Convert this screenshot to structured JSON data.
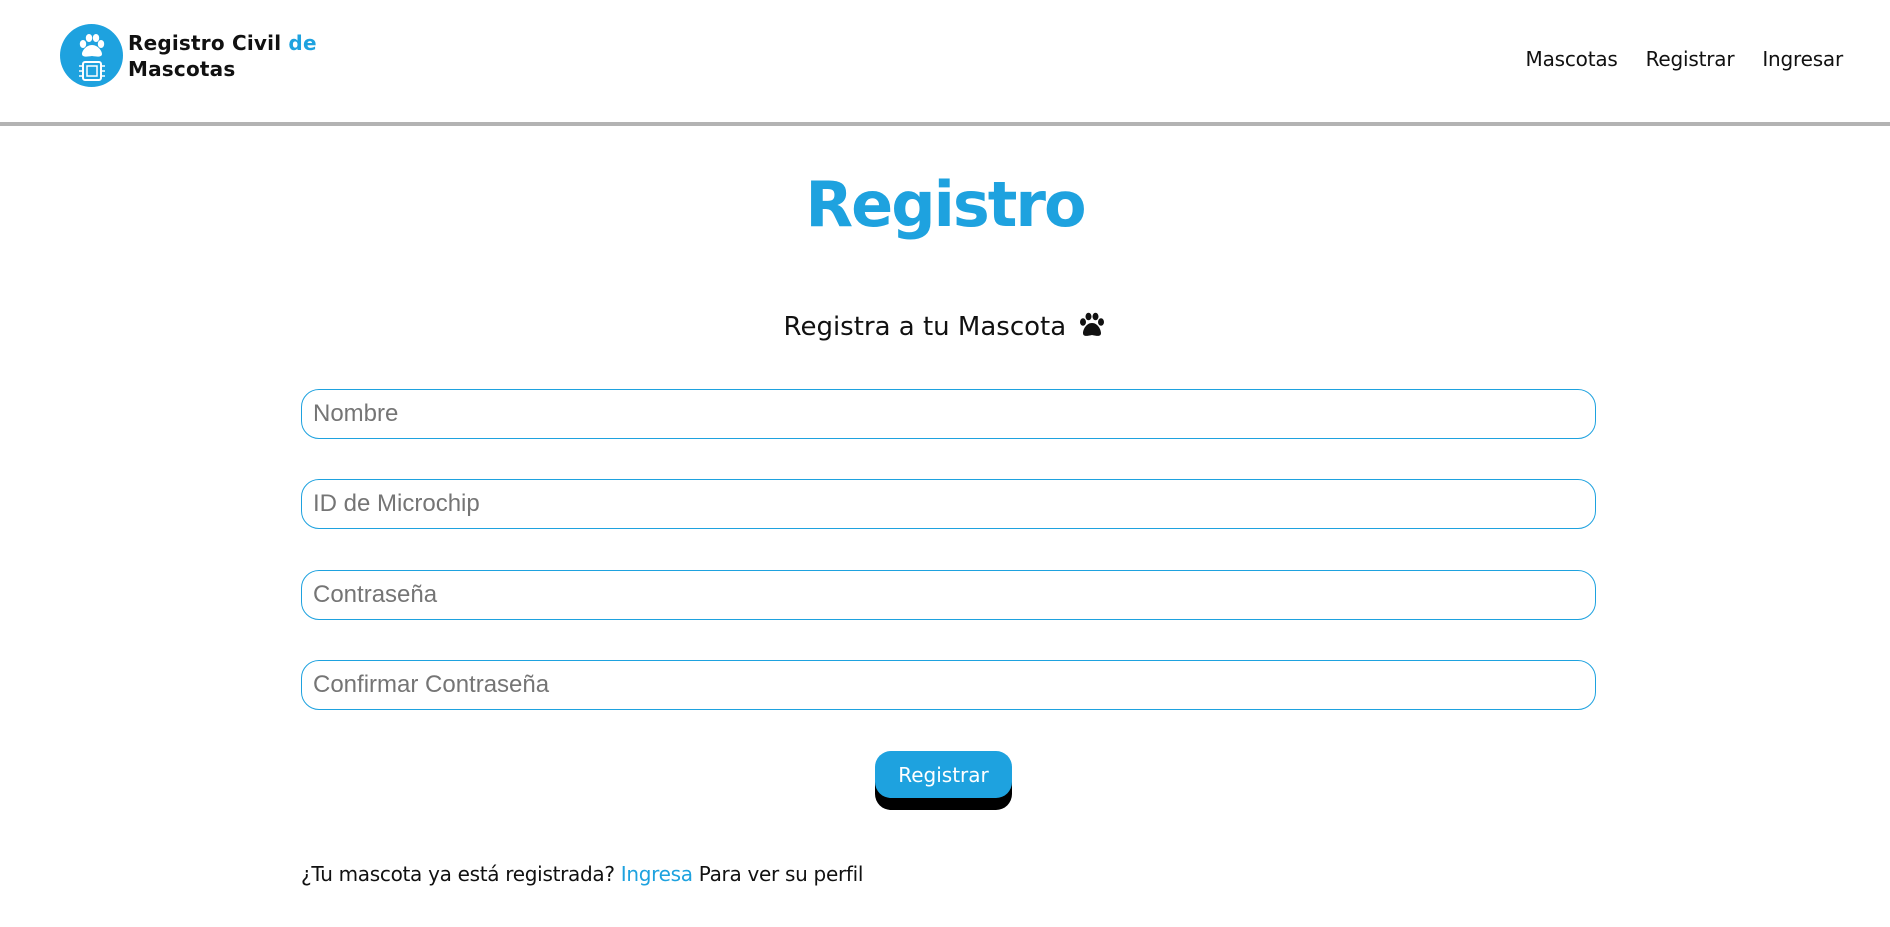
{
  "brand": {
    "name_part1": "Registro Civil",
    "name_accent": "de",
    "name_part2": "Mascotas",
    "logo_icon": "paw-microchip-icon",
    "accent_color": "#1ea2df"
  },
  "nav": {
    "items": [
      {
        "label": "Mascotas"
      },
      {
        "label": "Registrar"
      },
      {
        "label": "Ingresar"
      }
    ]
  },
  "main": {
    "title": "Registro",
    "subtitle": "Registra a tu Mascota",
    "subtitle_icon": "paw-icon"
  },
  "form": {
    "name": {
      "placeholder": "Nombre",
      "value": ""
    },
    "microchip": {
      "placeholder": "ID de Microchip",
      "value": ""
    },
    "password": {
      "placeholder": "Contraseña",
      "value": ""
    },
    "confirm_password": {
      "placeholder": "Confirmar Contraseña",
      "value": ""
    },
    "submit_label": "Registrar"
  },
  "footer": {
    "prompt": "¿Tu mascota ya está registrada?",
    "link_label": "Ingresa",
    "suffix": "Para ver su perfil"
  }
}
